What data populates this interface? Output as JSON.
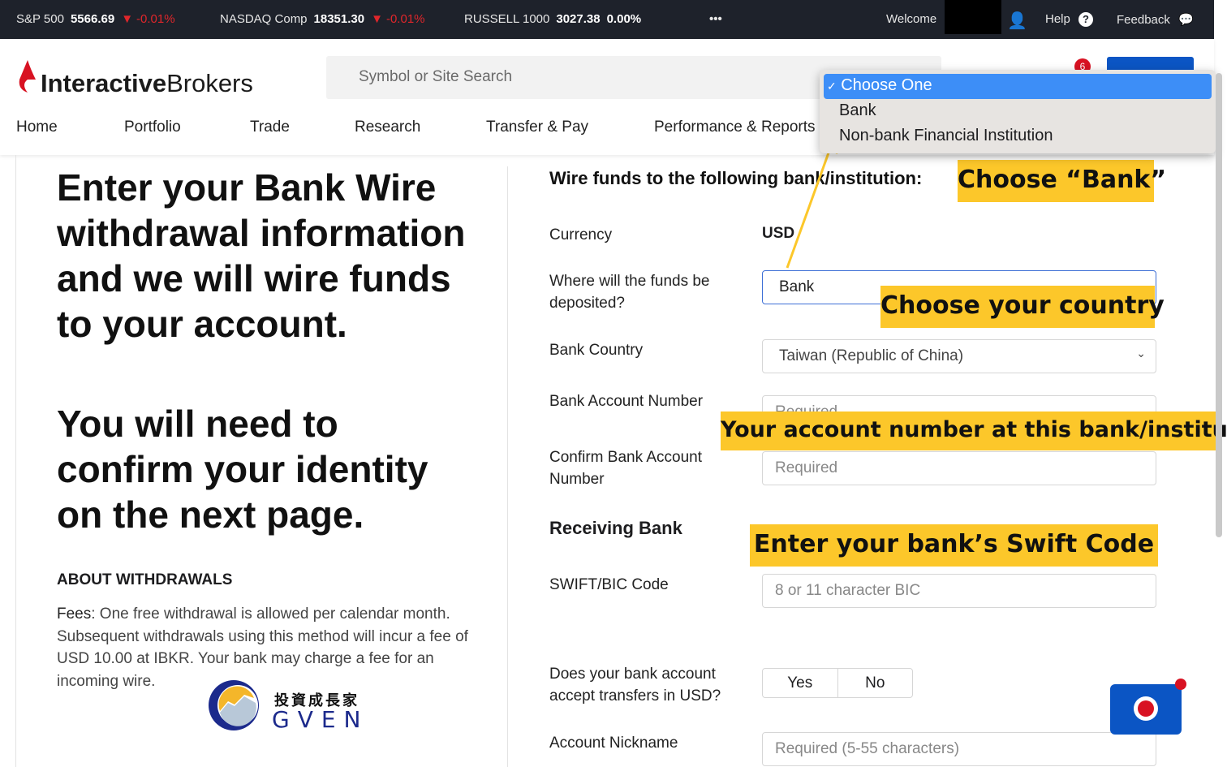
{
  "ticker": [
    {
      "name": "S&P 500",
      "value": "5566.69",
      "change": "-0.01%",
      "direction": "down"
    },
    {
      "name": "NASDAQ Comp",
      "value": "18351.30",
      "change": "-0.01%",
      "direction": "down"
    },
    {
      "name": "RUSSELL 1000",
      "value": "3027.38",
      "change": "0.00%",
      "direction": "flat"
    }
  ],
  "topbar": {
    "more": "•••",
    "welcome": "Welcome",
    "help": "Help",
    "feedback": "Feedback"
  },
  "logo": {
    "text_a": "Interactive",
    "text_b": "Brokers"
  },
  "search": {
    "placeholder": "Symbol or Site Search"
  },
  "notifications": {
    "count": "6"
  },
  "nav": [
    "Home",
    "Portfolio",
    "Trade",
    "Research",
    "Transfer & Pay",
    "Performance & Reports"
  ],
  "dropdown": {
    "options": [
      "Choose One",
      "Bank",
      "Non-bank Financial Institution"
    ],
    "selected": "Choose One",
    "check": "✓"
  },
  "left": {
    "heading1": "Enter your Bank Wire withdrawal information and we will wire funds to your account.",
    "heading2": "You will need to confirm your identity on the next page.",
    "about_title": "ABOUT WITHDRAWALS",
    "fees_label": "Fees",
    "fees_text": ": One free withdrawal is allowed per calendar month. Subsequent withdrawals using this method will incur a fee of USD 10.00 at IBKR. Your bank may charge a fee for an incoming wire.",
    "watermark": {
      "cn": "投資成長家",
      "en": "GVEN"
    }
  },
  "form": {
    "title": "Wire funds to the following bank/institution:",
    "currency_label": "Currency",
    "currency_value": "USD",
    "deposit_label": "Where will the funds be deposited?",
    "deposit_value": "Bank",
    "country_label": "Bank Country",
    "country_value": "Taiwan (Republic of China)",
    "account_label": "Bank Account Number",
    "account_placeholder": "Required",
    "confirm_label": "Confirm Bank Account Number",
    "confirm_placeholder": "Required",
    "receiving_title": "Receiving Bank",
    "swift_label": "SWIFT/BIC Code",
    "swift_placeholder": "8 or 11 character BIC",
    "usd_label": "Does your bank account accept transfers in USD?",
    "yes": "Yes",
    "no": "No",
    "nickname_label": "Account Nickname",
    "nickname_placeholder": "Required (5-55 characters)"
  },
  "callouts": {
    "bank": "Choose “Bank”",
    "country": "Choose your country",
    "account": "Your account number at this bank/institution",
    "swift": "Enter your bank’s Swift Code"
  },
  "colors": {
    "callout": "#fcc72a",
    "brand_red": "#d81222",
    "selected": "#3d8ef7",
    "ticker_bg": "#1e222b"
  }
}
